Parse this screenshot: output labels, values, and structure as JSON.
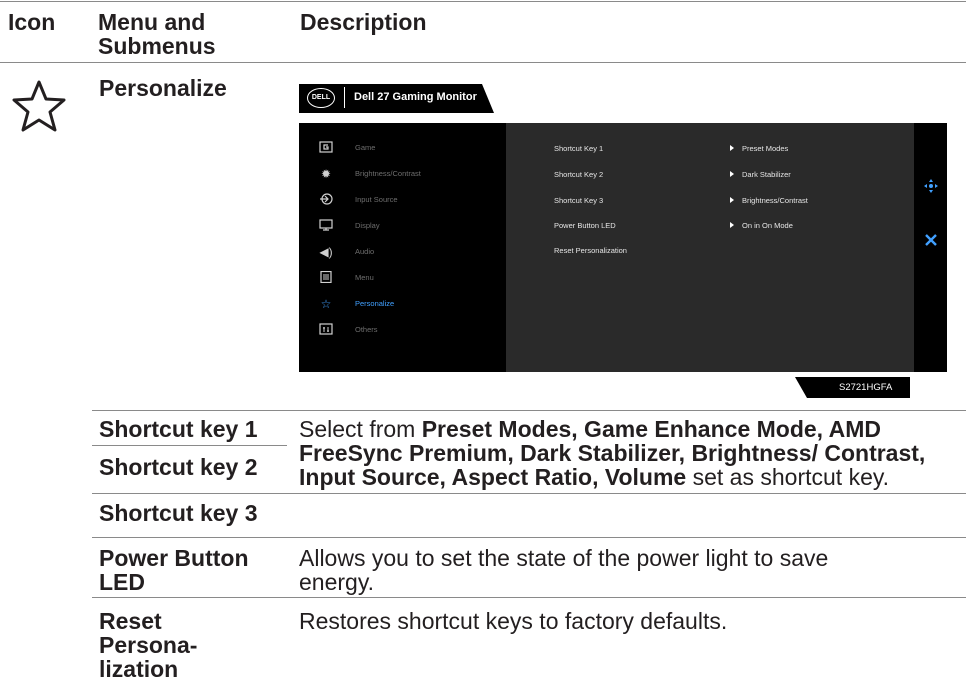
{
  "header": {
    "col_icon": "Icon",
    "col_menu_line1": "Menu and",
    "col_menu_line2": "Submenus",
    "col_desc": "Description"
  },
  "section": {
    "title": "Personalize",
    "icon": "star-outline-icon"
  },
  "monitor": {
    "brand": "DELL",
    "title": "Dell 27 Gaming Monitor",
    "model": "S2721HGFA"
  },
  "osd": {
    "menu": [
      {
        "icon": "game-icon",
        "label": "Game"
      },
      {
        "icon": "brightness-icon",
        "label": "Brightness/Contrast"
      },
      {
        "icon": "input-source-icon",
        "label": "Input Source"
      },
      {
        "icon": "display-icon",
        "label": "Display"
      },
      {
        "icon": "audio-icon",
        "label": "Audio"
      },
      {
        "icon": "menu-icon",
        "label": "Menu"
      },
      {
        "icon": "star-icon",
        "label": "Personalize",
        "active": true
      },
      {
        "icon": "others-icon",
        "label": "Others"
      }
    ],
    "options": [
      {
        "label": "Shortcut Key 1",
        "value": "Preset Modes"
      },
      {
        "label": "Shortcut Key 2",
        "value": "Dark Stabilizer"
      },
      {
        "label": "Shortcut Key 3",
        "value": "Brightness/Contrast"
      },
      {
        "label": "Power Button LED",
        "value": "On in On Mode"
      },
      {
        "label": "Reset Personalization",
        "value": ""
      }
    ],
    "accent_color": "#41a0ff"
  },
  "rows": {
    "shortcut1": "Shortcut key 1",
    "shortcut2": "Shortcut key 2",
    "shortcut3": "Shortcut key 3",
    "shortcut_desc_1": "Select from ",
    "shortcut_desc_bold1": "Preset Modes, Game Enhance Mode, AMD FreeSync Premium, Dark Stabilizer, Brightness/ Contrast, Input Source, Aspect Ratio, Volume",
    "shortcut_desc_2": " set as shortcut key.",
    "power_line1": "Power Button",
    "power_line2": "LED",
    "power_desc": "Allows you to set the state of the power light to save energy.",
    "reset_line1": "Reset",
    "reset_line2": "Persona-",
    "reset_line3": "lization",
    "reset_desc": "Restores shortcut keys to factory defaults."
  }
}
